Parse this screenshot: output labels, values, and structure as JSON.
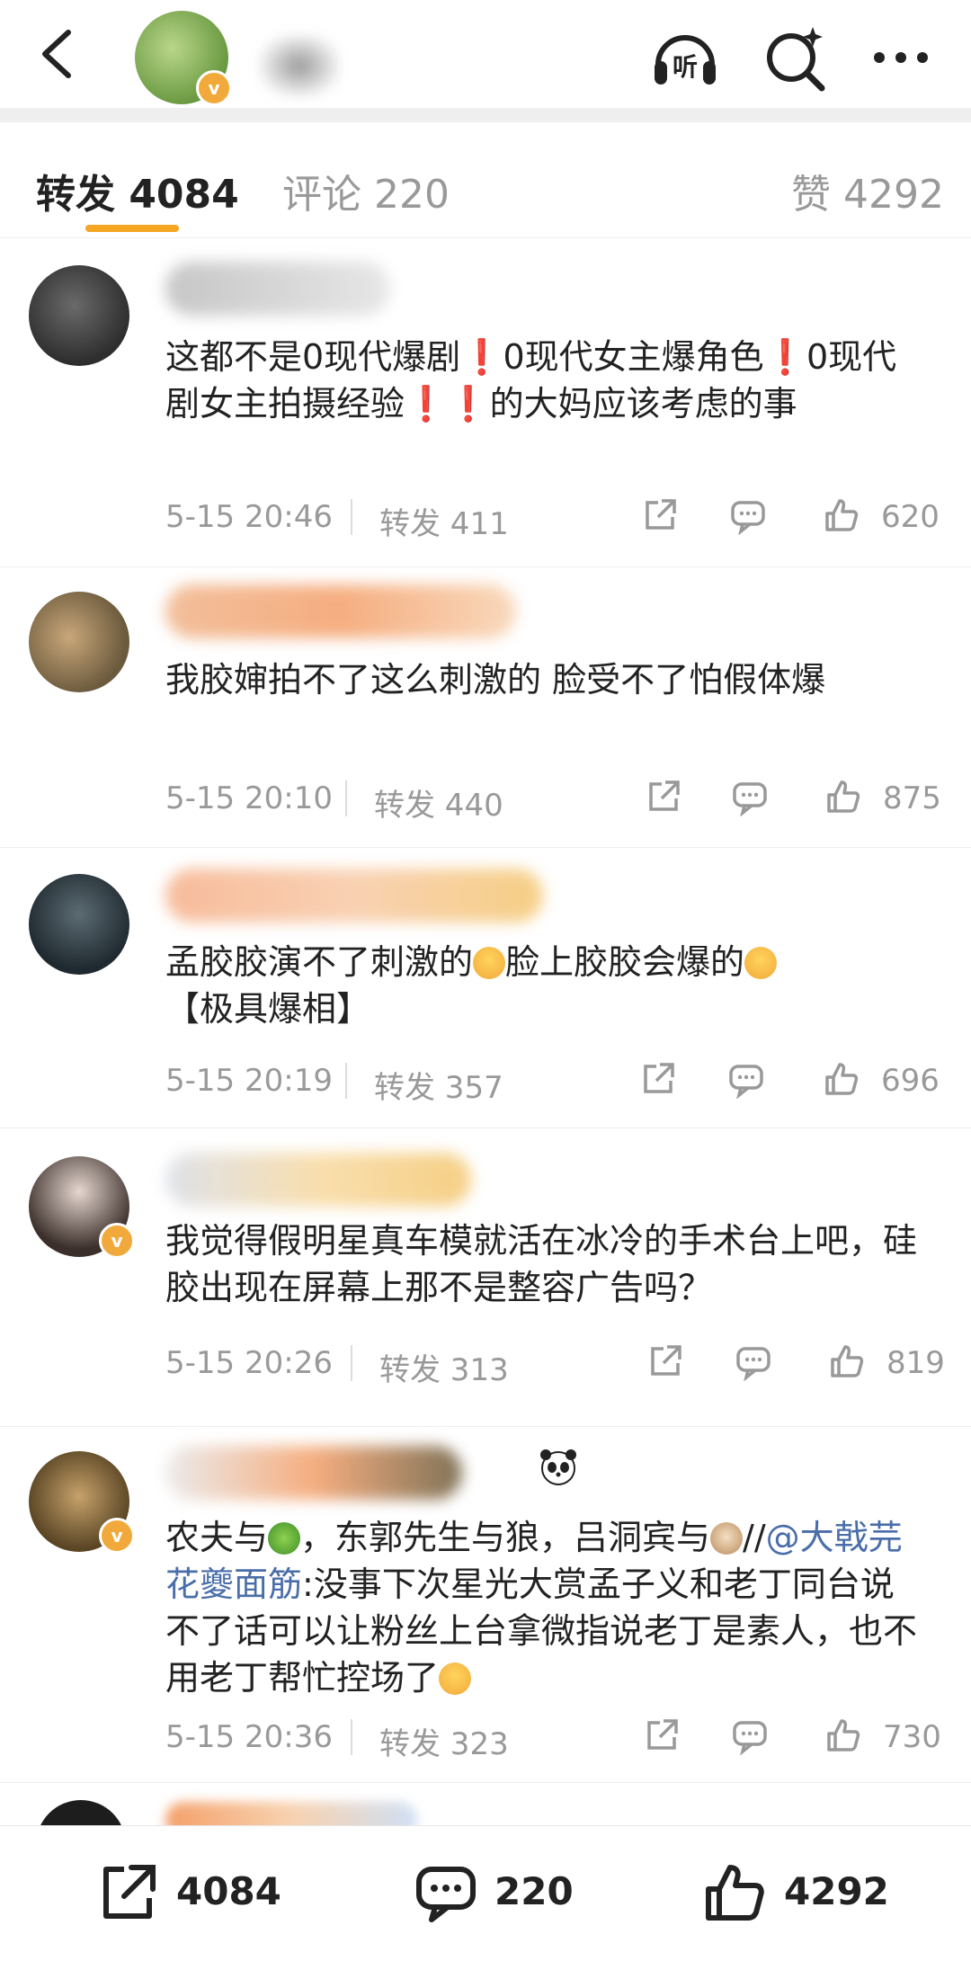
{
  "header": {
    "back_icon": "chevron-left-icon",
    "listen_label": "听",
    "search_icon": "search-sparkle-icon",
    "more_icon": "more-horizontal-icon",
    "verified_badge": "v"
  },
  "tabs": [
    {
      "label": "转发 4084",
      "active": true
    },
    {
      "label": "评论 220",
      "active": false
    },
    {
      "label": "赞 4292",
      "active": false
    }
  ],
  "accent_color": "#f5a623",
  "comments": [
    {
      "text": "这都不是0现代爆剧❗0现代女主爆角色❗0现代剧女主拍摄经验❗❗的大妈应该考虑的事",
      "time": "5-15 20:46",
      "repost": "转发 411",
      "likes": "620"
    },
    {
      "text": "我胶婶拍不了这么刺激的 脸受不了怕假体爆",
      "time": "5-15 20:10",
      "repost": "转发 440",
      "likes": "875"
    },
    {
      "text_a": "孟胶胶演不了刺激的",
      "text_b": "脸上胶胶会爆的",
      "text_c": "【极具爆相】",
      "time": "5-15 20:19",
      "repost": "转发 357",
      "likes": "696"
    },
    {
      "text": "我觉得假明星真车模就活在冰冷的手术台上吧，硅胶出现在屏幕上那不是整容广告吗？",
      "time": "5-15 20:26",
      "repost": "转发 313",
      "likes": "819"
    },
    {
      "text_a": "农夫与",
      "text_b": "，东郭先生与狼，吕洞宾与",
      "text_c": "//",
      "mention": "@大戟芫花夔面筋",
      "text_d": ":没事下次星光大赏孟子义和老丁同台说不了话可以让粉丝上台拿微指说老丁是素人，也不用老丁帮忙控场了",
      "time": "5-15 20:36",
      "repost": "转发 323",
      "likes": "730"
    }
  ],
  "bottom_bar": {
    "repost_count": "4084",
    "comment_count": "220",
    "like_count": "4292"
  }
}
